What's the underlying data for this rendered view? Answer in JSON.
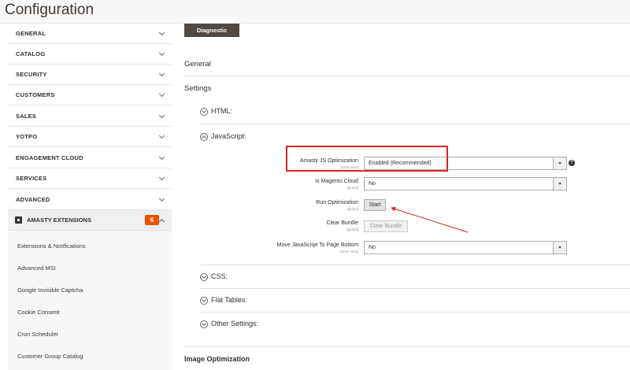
{
  "page": {
    "title": "Configuration"
  },
  "sidebar": {
    "items": [
      {
        "label": "GENERAL"
      },
      {
        "label": "CATALOG"
      },
      {
        "label": "SECURITY"
      },
      {
        "label": "CUSTOMERS"
      },
      {
        "label": "SALES"
      },
      {
        "label": "YOTPO"
      },
      {
        "label": "ENGAGEMENT CLOUD"
      },
      {
        "label": "SERVICES"
      },
      {
        "label": "ADVANCED"
      }
    ],
    "amasty": {
      "label": "AMASTY EXTENSIONS",
      "badge": "6"
    },
    "subitems": [
      {
        "label": "Extensions & Notifications"
      },
      {
        "label": "Advanced MSI"
      },
      {
        "label": "Google Invisible Captcha"
      },
      {
        "label": "Cookie Consent"
      },
      {
        "label": "Cron Scheduler"
      },
      {
        "label": "Customer Group Catalog"
      }
    ]
  },
  "main": {
    "diagnostic_button": "Diagnostic",
    "sections": {
      "general": "General",
      "settings": "Settings",
      "image_optimization": "Image Optimization"
    },
    "groups": {
      "html": "HTML:",
      "javascript": "JavaScript:",
      "css": "CSS:",
      "flat_tables": "Flat Tables:",
      "other_settings": "Other Settings:"
    },
    "js_settings": {
      "amasty_js_optimization": {
        "label": "Amasty JS Optimization",
        "scope": "[store view]",
        "value": "Enabled (Recommended)"
      },
      "is_magento_cloud": {
        "label": "Is Magento Cloud",
        "scope": "[global]",
        "value": "No"
      },
      "run_optimization": {
        "label": "Run Optimization",
        "scope": "[global]",
        "button": "Start"
      },
      "clear_bundle": {
        "label": "Clear Bundle",
        "scope": "[global]",
        "button": "Clear Bundle"
      },
      "move_js_bottom": {
        "label": "Move JavaScript To Page Bottom",
        "scope": "[store view]",
        "value": "No"
      }
    },
    "help_icon": "?"
  },
  "colors": {
    "accent": "#eb5202",
    "highlight": "#d32626",
    "button_dark": "#514943"
  }
}
